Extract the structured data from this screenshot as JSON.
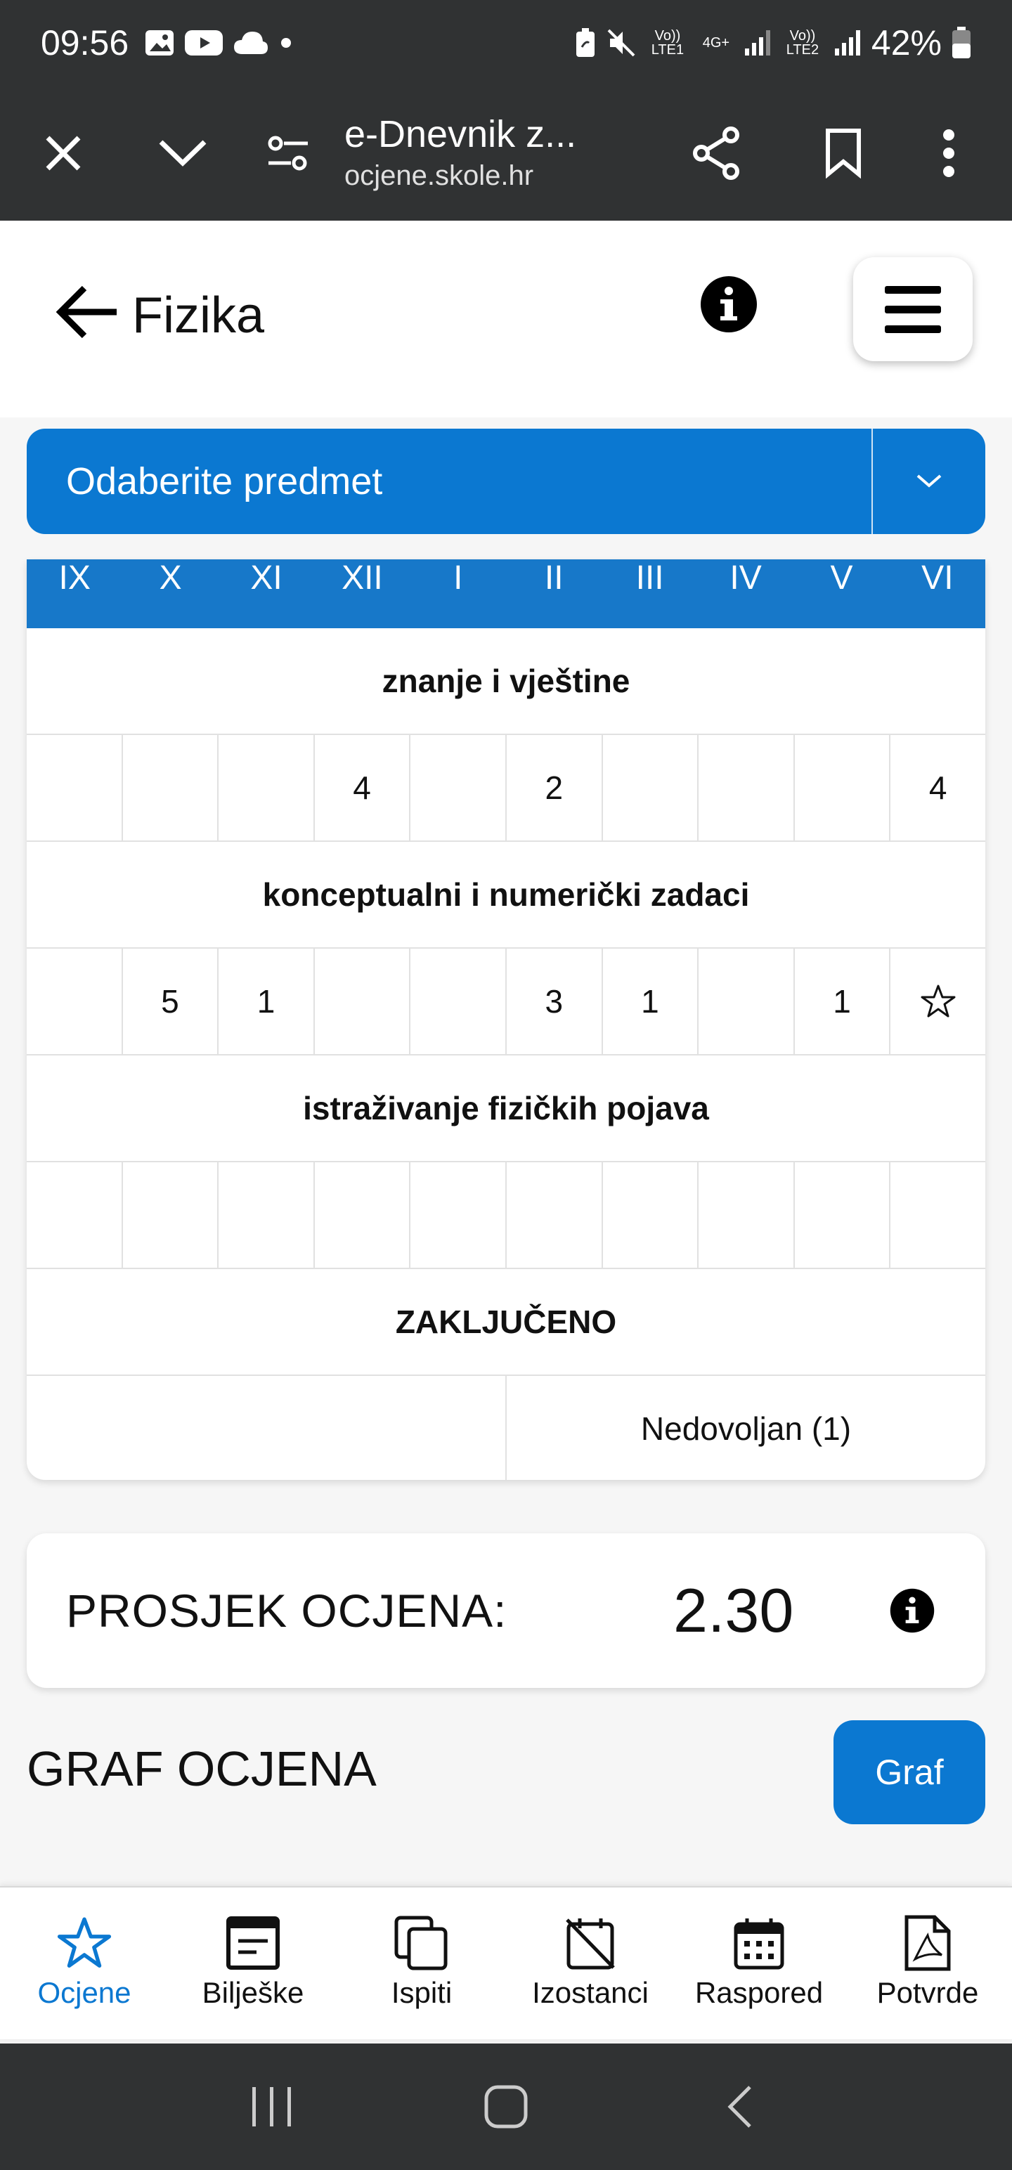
{
  "status_bar": {
    "time": "09:56",
    "battery": "42%",
    "sim1": "Vo)) LTE1",
    "sim2": "Vo)) LTE2",
    "network": "4G+"
  },
  "browser": {
    "title": "e-Dnevnik z...",
    "url": "ocjene.skole.hr"
  },
  "header": {
    "subject": "Fizika"
  },
  "subject_select": {
    "label": "Odaberite predmet"
  },
  "grades": {
    "months": [
      "IX",
      "X",
      "XI",
      "XII",
      "I",
      "II",
      "III",
      "IV",
      "V",
      "VI"
    ],
    "categories": [
      {
        "name": "znanje i vještine",
        "cells": [
          "",
          "",
          "",
          "4",
          "",
          "2",
          "",
          "",
          "",
          "4"
        ]
      },
      {
        "name": "konceptualni i numerički zadaci",
        "cells": [
          "",
          "5",
          "1",
          "",
          "",
          "3",
          "1",
          "",
          "1",
          "★"
        ]
      },
      {
        "name": "istraživanje fizičkih pojava",
        "cells": [
          "",
          "",
          "",
          "",
          "",
          "",
          "",
          "",
          "",
          ""
        ]
      }
    ],
    "final_label": "ZAKLJUČENO",
    "final_left": "",
    "final_right": "Nedovoljan (1)"
  },
  "average": {
    "label": "PROSJEK OCJENA:",
    "value": "2.30"
  },
  "graf": {
    "title": "GRAF OCJENA",
    "button_label": "Graf"
  },
  "bottom_nav": {
    "items": [
      {
        "label": "Ocjene",
        "icon": "star-icon",
        "active": true
      },
      {
        "label": "Bilješke",
        "icon": "notes-icon",
        "active": false
      },
      {
        "label": "Ispiti",
        "icon": "copy-icon",
        "active": false
      },
      {
        "label": "Izostanci",
        "icon": "calendar-off-icon",
        "active": false
      },
      {
        "label": "Raspored",
        "icon": "calendar-icon",
        "active": false
      },
      {
        "label": "Potvrde",
        "icon": "pdf-icon",
        "active": false
      }
    ]
  },
  "colors": {
    "primary": "#0b78d1",
    "table_header": "#1778c9",
    "dark_bar": "#303233"
  }
}
